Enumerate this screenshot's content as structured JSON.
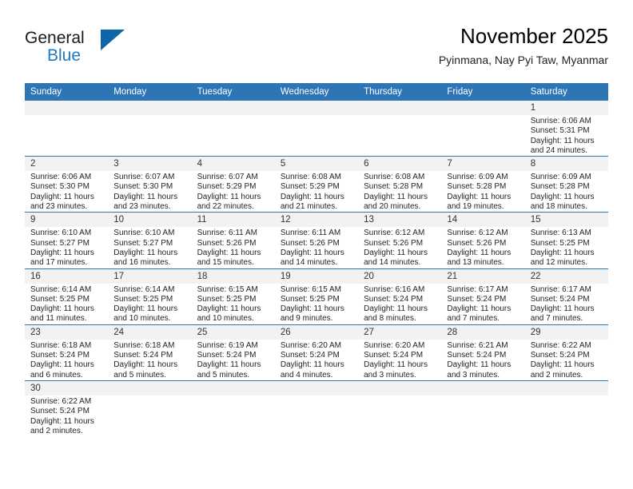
{
  "brand": {
    "word_one": "General",
    "word_two": "Blue",
    "accent_color": "#1f7ac0",
    "triangle_color": "#1065a8",
    "triangle_icon": "triangle-icon"
  },
  "header": {
    "title": "November 2025",
    "subtitle": "Pyinmana, Nay Pyi Taw, Myanmar"
  },
  "theme": {
    "header_bg": "#2e75b6",
    "daynum_bg": "#f2f2f2",
    "grid_line": "#2e75b6",
    "text": "#242424"
  },
  "weekdays": [
    "Sunday",
    "Monday",
    "Tuesday",
    "Wednesday",
    "Thursday",
    "Friday",
    "Saturday"
  ],
  "weeks": [
    [
      {
        "day": "",
        "empty": true
      },
      {
        "day": "",
        "empty": true
      },
      {
        "day": "",
        "empty": true
      },
      {
        "day": "",
        "empty": true
      },
      {
        "day": "",
        "empty": true
      },
      {
        "day": "",
        "empty": true
      },
      {
        "day": "1",
        "sunrise": "Sunrise: 6:06 AM",
        "sunset": "Sunset: 5:31 PM",
        "daylight_1": "Daylight: 11 hours",
        "daylight_2": "and 24 minutes."
      }
    ],
    [
      {
        "day": "2",
        "sunrise": "Sunrise: 6:06 AM",
        "sunset": "Sunset: 5:30 PM",
        "daylight_1": "Daylight: 11 hours",
        "daylight_2": "and 23 minutes."
      },
      {
        "day": "3",
        "sunrise": "Sunrise: 6:07 AM",
        "sunset": "Sunset: 5:30 PM",
        "daylight_1": "Daylight: 11 hours",
        "daylight_2": "and 23 minutes."
      },
      {
        "day": "4",
        "sunrise": "Sunrise: 6:07 AM",
        "sunset": "Sunset: 5:29 PM",
        "daylight_1": "Daylight: 11 hours",
        "daylight_2": "and 22 minutes."
      },
      {
        "day": "5",
        "sunrise": "Sunrise: 6:08 AM",
        "sunset": "Sunset: 5:29 PM",
        "daylight_1": "Daylight: 11 hours",
        "daylight_2": "and 21 minutes."
      },
      {
        "day": "6",
        "sunrise": "Sunrise: 6:08 AM",
        "sunset": "Sunset: 5:28 PM",
        "daylight_1": "Daylight: 11 hours",
        "daylight_2": "and 20 minutes."
      },
      {
        "day": "7",
        "sunrise": "Sunrise: 6:09 AM",
        "sunset": "Sunset: 5:28 PM",
        "daylight_1": "Daylight: 11 hours",
        "daylight_2": "and 19 minutes."
      },
      {
        "day": "8",
        "sunrise": "Sunrise: 6:09 AM",
        "sunset": "Sunset: 5:28 PM",
        "daylight_1": "Daylight: 11 hours",
        "daylight_2": "and 18 minutes."
      }
    ],
    [
      {
        "day": "9",
        "sunrise": "Sunrise: 6:10 AM",
        "sunset": "Sunset: 5:27 PM",
        "daylight_1": "Daylight: 11 hours",
        "daylight_2": "and 17 minutes."
      },
      {
        "day": "10",
        "sunrise": "Sunrise: 6:10 AM",
        "sunset": "Sunset: 5:27 PM",
        "daylight_1": "Daylight: 11 hours",
        "daylight_2": "and 16 minutes."
      },
      {
        "day": "11",
        "sunrise": "Sunrise: 6:11 AM",
        "sunset": "Sunset: 5:26 PM",
        "daylight_1": "Daylight: 11 hours",
        "daylight_2": "and 15 minutes."
      },
      {
        "day": "12",
        "sunrise": "Sunrise: 6:11 AM",
        "sunset": "Sunset: 5:26 PM",
        "daylight_1": "Daylight: 11 hours",
        "daylight_2": "and 14 minutes."
      },
      {
        "day": "13",
        "sunrise": "Sunrise: 6:12 AM",
        "sunset": "Sunset: 5:26 PM",
        "daylight_1": "Daylight: 11 hours",
        "daylight_2": "and 14 minutes."
      },
      {
        "day": "14",
        "sunrise": "Sunrise: 6:12 AM",
        "sunset": "Sunset: 5:26 PM",
        "daylight_1": "Daylight: 11 hours",
        "daylight_2": "and 13 minutes."
      },
      {
        "day": "15",
        "sunrise": "Sunrise: 6:13 AM",
        "sunset": "Sunset: 5:25 PM",
        "daylight_1": "Daylight: 11 hours",
        "daylight_2": "and 12 minutes."
      }
    ],
    [
      {
        "day": "16",
        "sunrise": "Sunrise: 6:14 AM",
        "sunset": "Sunset: 5:25 PM",
        "daylight_1": "Daylight: 11 hours",
        "daylight_2": "and 11 minutes."
      },
      {
        "day": "17",
        "sunrise": "Sunrise: 6:14 AM",
        "sunset": "Sunset: 5:25 PM",
        "daylight_1": "Daylight: 11 hours",
        "daylight_2": "and 10 minutes."
      },
      {
        "day": "18",
        "sunrise": "Sunrise: 6:15 AM",
        "sunset": "Sunset: 5:25 PM",
        "daylight_1": "Daylight: 11 hours",
        "daylight_2": "and 10 minutes."
      },
      {
        "day": "19",
        "sunrise": "Sunrise: 6:15 AM",
        "sunset": "Sunset: 5:25 PM",
        "daylight_1": "Daylight: 11 hours",
        "daylight_2": "and 9 minutes."
      },
      {
        "day": "20",
        "sunrise": "Sunrise: 6:16 AM",
        "sunset": "Sunset: 5:24 PM",
        "daylight_1": "Daylight: 11 hours",
        "daylight_2": "and 8 minutes."
      },
      {
        "day": "21",
        "sunrise": "Sunrise: 6:17 AM",
        "sunset": "Sunset: 5:24 PM",
        "daylight_1": "Daylight: 11 hours",
        "daylight_2": "and 7 minutes."
      },
      {
        "day": "22",
        "sunrise": "Sunrise: 6:17 AM",
        "sunset": "Sunset: 5:24 PM",
        "daylight_1": "Daylight: 11 hours",
        "daylight_2": "and 7 minutes."
      }
    ],
    [
      {
        "day": "23",
        "sunrise": "Sunrise: 6:18 AM",
        "sunset": "Sunset: 5:24 PM",
        "daylight_1": "Daylight: 11 hours",
        "daylight_2": "and 6 minutes."
      },
      {
        "day": "24",
        "sunrise": "Sunrise: 6:18 AM",
        "sunset": "Sunset: 5:24 PM",
        "daylight_1": "Daylight: 11 hours",
        "daylight_2": "and 5 minutes."
      },
      {
        "day": "25",
        "sunrise": "Sunrise: 6:19 AM",
        "sunset": "Sunset: 5:24 PM",
        "daylight_1": "Daylight: 11 hours",
        "daylight_2": "and 5 minutes."
      },
      {
        "day": "26",
        "sunrise": "Sunrise: 6:20 AM",
        "sunset": "Sunset: 5:24 PM",
        "daylight_1": "Daylight: 11 hours",
        "daylight_2": "and 4 minutes."
      },
      {
        "day": "27",
        "sunrise": "Sunrise: 6:20 AM",
        "sunset": "Sunset: 5:24 PM",
        "daylight_1": "Daylight: 11 hours",
        "daylight_2": "and 3 minutes."
      },
      {
        "day": "28",
        "sunrise": "Sunrise: 6:21 AM",
        "sunset": "Sunset: 5:24 PM",
        "daylight_1": "Daylight: 11 hours",
        "daylight_2": "and 3 minutes."
      },
      {
        "day": "29",
        "sunrise": "Sunrise: 6:22 AM",
        "sunset": "Sunset: 5:24 PM",
        "daylight_1": "Daylight: 11 hours",
        "daylight_2": "and 2 minutes."
      }
    ],
    [
      {
        "day": "30",
        "sunrise": "Sunrise: 6:22 AM",
        "sunset": "Sunset: 5:24 PM",
        "daylight_1": "Daylight: 11 hours",
        "daylight_2": "and 2 minutes."
      },
      {
        "day": "",
        "blank": true
      },
      {
        "day": "",
        "blank": true
      },
      {
        "day": "",
        "blank": true
      },
      {
        "day": "",
        "blank": true
      },
      {
        "day": "",
        "blank": true
      },
      {
        "day": "",
        "blank": true
      }
    ]
  ]
}
